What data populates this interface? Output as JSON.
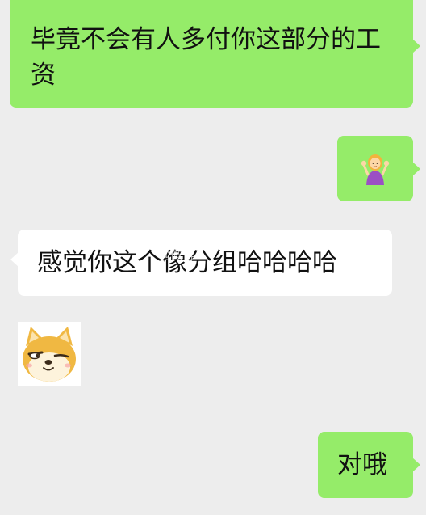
{
  "messages": [
    {
      "id": "msg1",
      "side": "outgoing",
      "text": "毕竟不会有人多付你这部分的工资"
    },
    {
      "id": "msg2",
      "side": "outgoing",
      "emoji": "person-shrugging-emoji"
    },
    {
      "id": "msg3",
      "side": "incoming",
      "text": "感觉你这个像分组哈哈哈哈"
    },
    {
      "id": "sticker",
      "side": "incoming",
      "sticker": "shiba-dog-smirk-sticker"
    },
    {
      "id": "msg4",
      "side": "outgoing",
      "text": "对哦"
    }
  ],
  "watermark": "@微博",
  "colors": {
    "background": "#ededed",
    "outgoing_bubble": "#95ec69",
    "incoming_bubble": "#ffffff"
  }
}
